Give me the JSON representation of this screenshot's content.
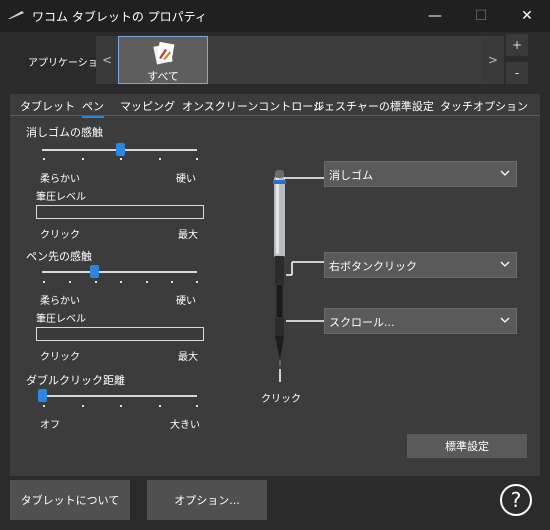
{
  "window": {
    "title": "ワコム タブレットの プロパティ",
    "minimize_glyph": "—",
    "maximize_glyph": "☐",
    "close_glyph": "✕"
  },
  "application_bar": {
    "label": "アプリケーション:",
    "left_arrow": "<",
    "right_arrow": ">",
    "add": "+",
    "remove": "-",
    "selected_app": "すべて"
  },
  "tabs": [
    "タブレット",
    "ペン",
    "マッピング",
    "オンスクリーンコントロール",
    "ジェスチャーの標準設定",
    "タッチオプション"
  ],
  "active_tab": "ペン",
  "eraser_feel": {
    "title": "消しゴムの感触",
    "min_label": "柔らかい",
    "max_label": "硬い",
    "level": 0.5,
    "pressure_title": "筆圧レベル",
    "pressure_min": "クリック",
    "pressure_max": "最大",
    "pressure_level": 0
  },
  "tip_feel": {
    "title": "ペン先の感触",
    "min_label": "柔らかい",
    "max_label": "硬い",
    "level": 0.333,
    "pressure_title": "筆圧レベル",
    "pressure_min": "クリック",
    "pressure_max": "最大",
    "pressure_level": 0
  },
  "double_click": {
    "title": "ダブルクリック距離",
    "min_label": "オフ",
    "max_label": "大きい",
    "level": 0
  },
  "pen_buttons": {
    "top_eraser": "消しゴム",
    "upper_button": "右ボタンクリック",
    "lower_button": "スクロール...",
    "tip_label": "クリック"
  },
  "standard_button": "標準設定",
  "footer": {
    "about": "タブレットについて",
    "options": "オプション...",
    "help": "?"
  },
  "colors": {
    "accent": "#2c87e0",
    "background": "#2b2b2b",
    "panel": "#3c3c3c"
  }
}
